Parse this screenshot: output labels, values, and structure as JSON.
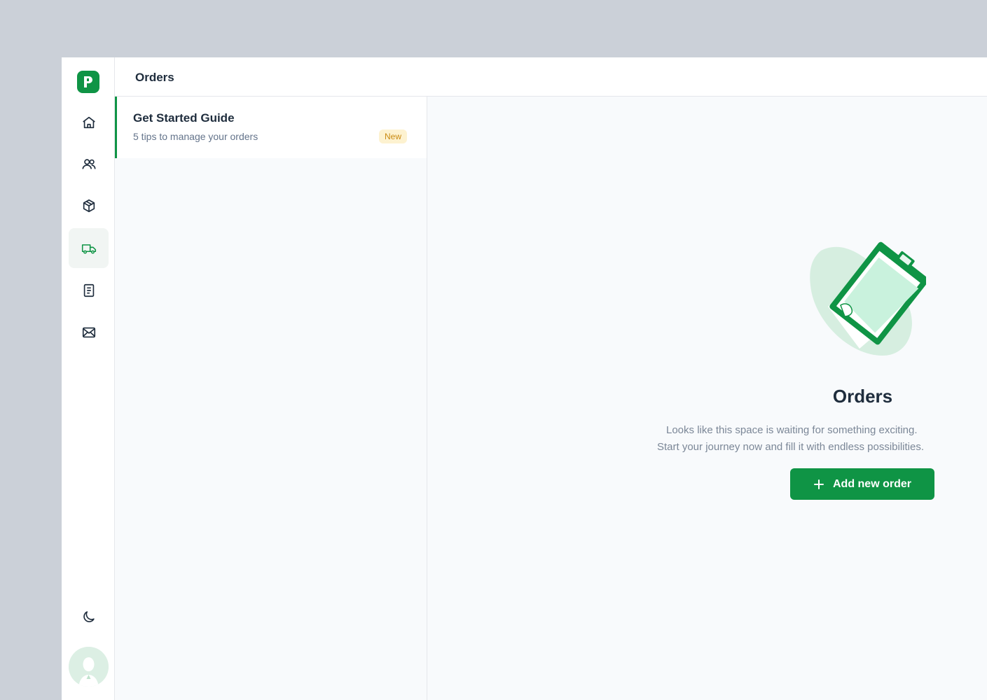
{
  "header": {
    "title": "Orders"
  },
  "sidebar": {
    "logo_icon": "p-logo-icon",
    "items": [
      {
        "name": "home",
        "icon": "home-icon",
        "active": false
      },
      {
        "name": "customers",
        "icon": "users-icon",
        "active": false
      },
      {
        "name": "products",
        "icon": "box-icon",
        "active": false
      },
      {
        "name": "orders",
        "icon": "truck-icon",
        "active": true
      },
      {
        "name": "documents",
        "icon": "document-icon",
        "active": false
      },
      {
        "name": "messages",
        "icon": "mail-icon",
        "active": false
      }
    ],
    "theme_icon": "moon-icon"
  },
  "list": {
    "guide": {
      "title": "Get Started Guide",
      "subtitle": "5 tips to manage your orders",
      "badge": "New"
    }
  },
  "empty_state": {
    "title": "Orders",
    "line1": "Looks like this space is waiting for something exciting.",
    "line2": "Start your journey now and fill it with endless possibilities.",
    "button_label": "Add new order"
  },
  "colors": {
    "accent": "#0f9445",
    "badge_bg": "#fdf2d0",
    "badge_text": "#c98a12"
  }
}
